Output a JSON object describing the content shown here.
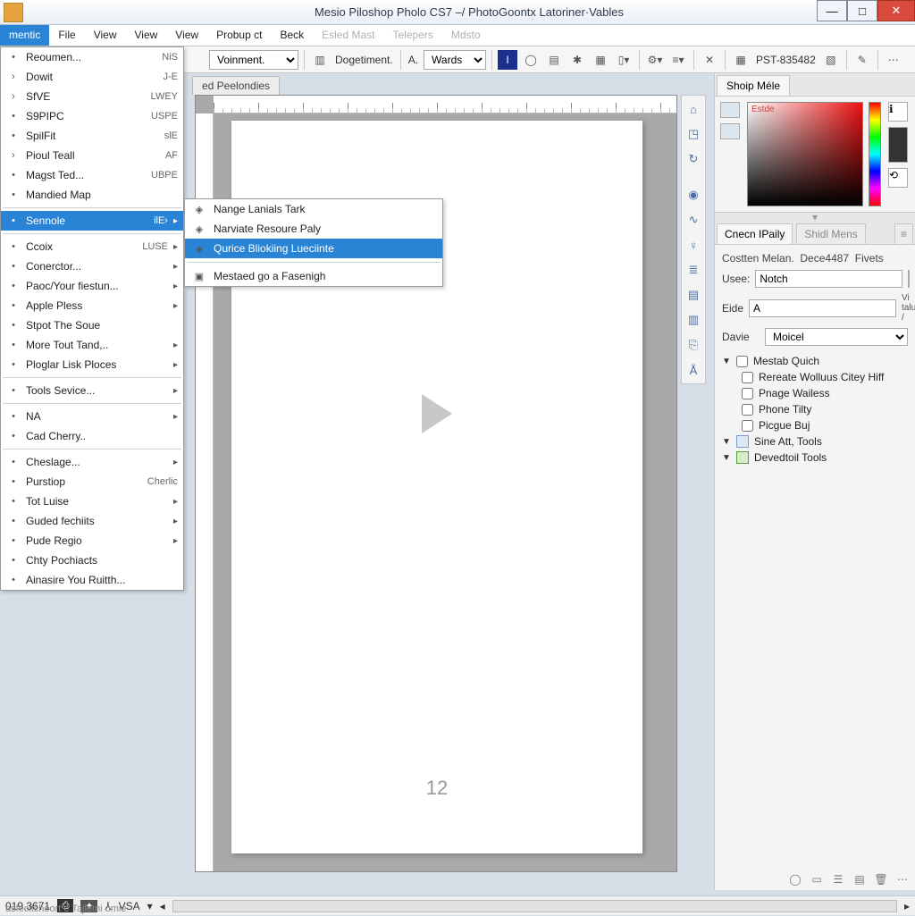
{
  "window": {
    "title": "Mesio Piloshop Pholo CS7 –/ PhotoGoontx Latoriner·Vables"
  },
  "winbuttons": {
    "min": "—",
    "max": "□",
    "close": "✕"
  },
  "menubar": {
    "items": [
      {
        "label": "mentic",
        "active": true
      },
      {
        "label": "File"
      },
      {
        "label": "View"
      },
      {
        "label": "View"
      },
      {
        "label": "View"
      },
      {
        "label": "Probup ct"
      },
      {
        "label": "Beck"
      },
      {
        "label": "Esled Mast",
        "dim": true
      },
      {
        "label": "Telepers",
        "dim": true
      },
      {
        "label": "Mdsto",
        "dim": true
      }
    ]
  },
  "toolbar": {
    "combo1": "Voinment.",
    "btn1": "Dogetiment.",
    "font_prefix": "A.",
    "font_combo": "Wards",
    "code": "PST-835482"
  },
  "doc_tab": {
    "label": "ed Peelondies"
  },
  "dropdown": {
    "groups": [
      [
        {
          "icon": "",
          "label": "Reoumen...",
          "hint": "NiS"
        },
        {
          "icon": "›",
          "label": "Dowit",
          "hint": "J-E"
        },
        {
          "icon": "›",
          "label": "SfVE",
          "hint": "LWEY"
        },
        {
          "icon": "",
          "label": "S9PIPC",
          "hint": "USPE"
        },
        {
          "icon": "",
          "label": "SpilFit",
          "hint": "slE"
        },
        {
          "icon": "›",
          "label": "Pioul Teall",
          "hint": "AF"
        },
        {
          "icon": "",
          "label": "Magst Ted...",
          "hint": "UBPE"
        },
        {
          "icon": "",
          "label": "Mandied Map",
          "hint": ""
        }
      ],
      [
        {
          "icon": "",
          "label": "Sennole",
          "hint": "ilE›",
          "hl": true,
          "arrow": true
        }
      ],
      [
        {
          "icon": "",
          "label": "Ccoix",
          "hint": "LUSE",
          "arrow": true
        },
        {
          "icon": "",
          "label": "Conerctor...",
          "arrow": true
        },
        {
          "icon": "",
          "label": "Paoc/Your fiestun...",
          "arrow": true
        },
        {
          "icon": "",
          "label": "Apple Pless",
          "arrow": true
        },
        {
          "icon": "",
          "label": "Stpot The Soue"
        },
        {
          "icon": "",
          "label": "More Tout Tand,..",
          "arrow": true
        },
        {
          "icon": "",
          "label": "Ploglar Lisk Ploces",
          "arrow": true
        }
      ],
      [
        {
          "icon": "",
          "label": "Tools Sevice...",
          "arrow": true
        }
      ],
      [
        {
          "icon": "",
          "label": "NA",
          "arrow": true
        },
        {
          "icon": "",
          "label": "Cad Cherry.."
        }
      ],
      [
        {
          "icon": "",
          "label": "Cheslage...",
          "arrow": true
        },
        {
          "icon": "",
          "label": "Purstiop",
          "hint": "Cherlic"
        },
        {
          "icon": "",
          "label": "Tot Luise",
          "arrow": true
        },
        {
          "icon": "",
          "label": "Guded fechiits",
          "arrow": true
        },
        {
          "icon": "",
          "label": "Pude Regio",
          "arrow": true
        },
        {
          "icon": "",
          "label": "Chty Pochiacts"
        },
        {
          "icon": "",
          "label": "Ainasire You Ruitth..."
        }
      ]
    ]
  },
  "submenu": {
    "items": [
      {
        "label": "Nange Lanials Tark"
      },
      {
        "label": "Narviate Resoure Paly"
      },
      {
        "label": "Qurice Bliokiing Lueciinte",
        "hl": true
      }
    ],
    "items2": [
      {
        "label": "Mestaed go a Fasenigh"
      }
    ]
  },
  "page": {
    "number": "12"
  },
  "right": {
    "tab1": "Shoip Méle",
    "picker_label": "Estde",
    "tab2a": "Cnecn IPaily",
    "tab2b": "Shidl Mens",
    "header": {
      "a": "Costten Melan.",
      "b": "Dece4487",
      "c": "Fivets"
    },
    "form": {
      "usee_label": "Usee:",
      "usee_value": "Notch",
      "eide_label": "Eide",
      "eide_value": "A",
      "eide_suffix": "Vi talur /",
      "davie_label": "Davie",
      "davie_value": "Moicel"
    },
    "tree": {
      "n1": "Mestab Quich",
      "n2": "Rereate Wolluus Citey Hiff",
      "n3": "Pnage Wailess",
      "n4": "Phone Tilty",
      "n5": "Picgue Buj",
      "n6": "Sine Att, Tools",
      "n7": "Devedtoil Tools"
    }
  },
  "status": {
    "num": "019.3671",
    "vsa": "VSA",
    "footer": "asfecitcheort e Tajlemi omie"
  }
}
